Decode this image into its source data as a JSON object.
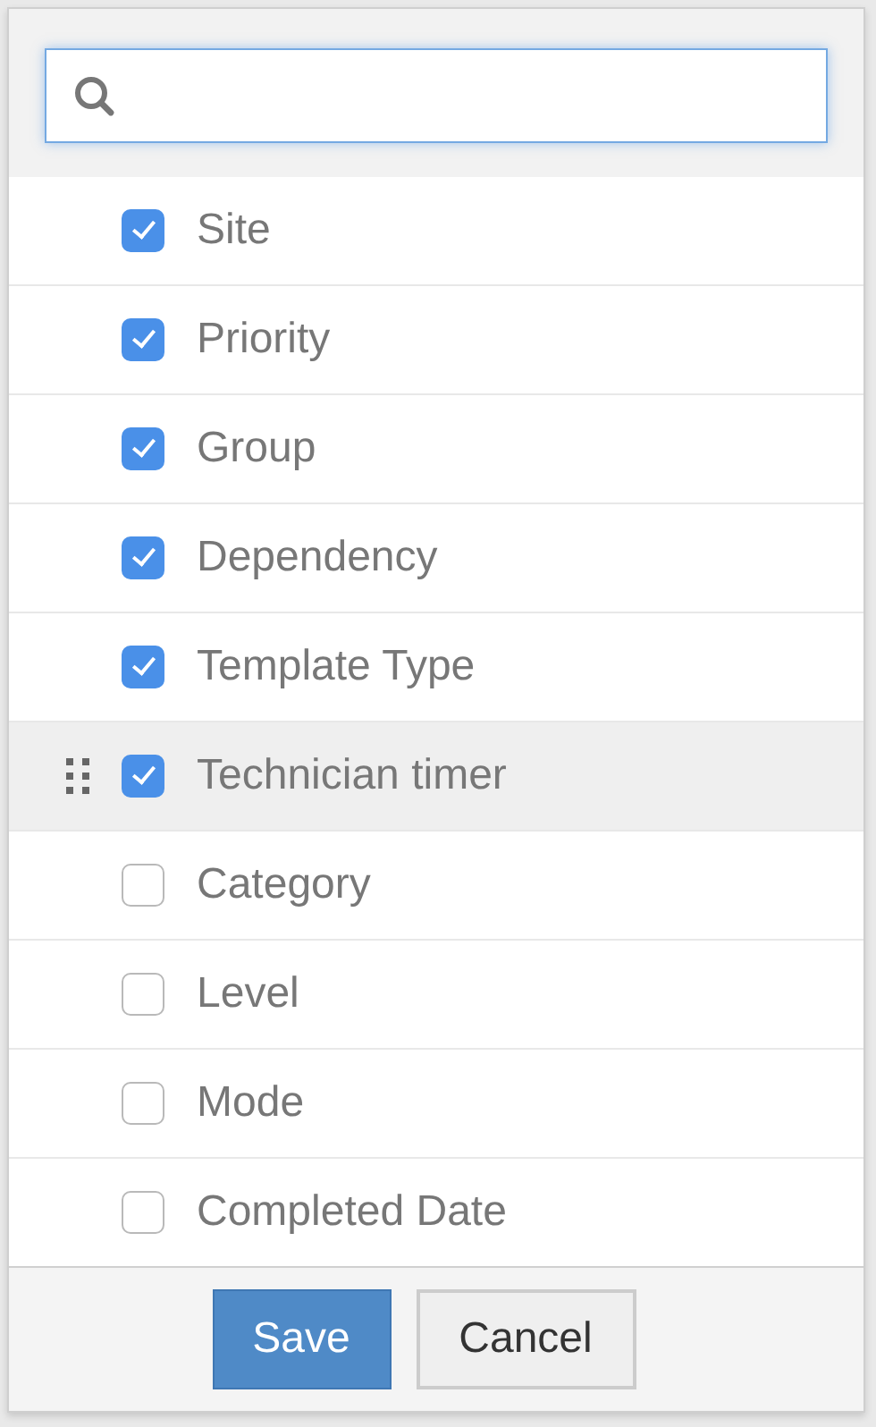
{
  "columns": [
    {
      "label": "Site",
      "checked": true,
      "highlighted": false
    },
    {
      "label": "Priority",
      "checked": true,
      "highlighted": false
    },
    {
      "label": "Group",
      "checked": true,
      "highlighted": false
    },
    {
      "label": "Dependency",
      "checked": true,
      "highlighted": false
    },
    {
      "label": "Template Type",
      "checked": true,
      "highlighted": false
    },
    {
      "label": "Technician timer",
      "checked": true,
      "highlighted": true
    },
    {
      "label": "Category",
      "checked": false,
      "highlighted": false
    },
    {
      "label": "Level",
      "checked": false,
      "highlighted": false
    },
    {
      "label": "Mode",
      "checked": false,
      "highlighted": false
    },
    {
      "label": "Completed Date",
      "checked": false,
      "highlighted": false
    }
  ],
  "buttons": [
    {
      "label": "Save",
      "kind": "primary"
    },
    {
      "label": "Cancel",
      "kind": "secondary"
    }
  ]
}
